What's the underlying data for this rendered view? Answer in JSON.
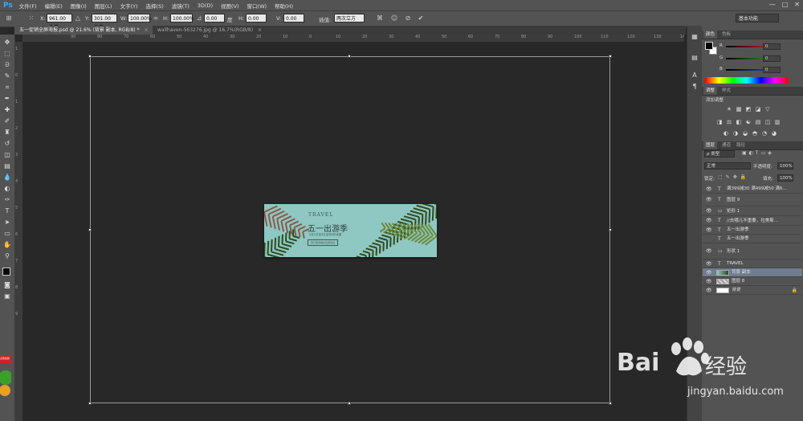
{
  "app": {
    "logo": "Ps"
  },
  "menu": [
    "文件(F)",
    "编辑(E)",
    "图像(I)",
    "图层(L)",
    "文字(Y)",
    "选择(S)",
    "滤镜(T)",
    "3D(D)",
    "视图(V)",
    "窗口(W)",
    "帮助(H)"
  ],
  "window_controls": [
    "—",
    "□",
    "✕"
  ],
  "options": {
    "x_label": "X:",
    "x_value": "961.00 像素",
    "y_label": "Y:",
    "y_value": "301.00 像素",
    "w_label": "W:",
    "w_value": "100.00%",
    "h_label": "H:",
    "h_value": "100.00%",
    "angle_value": "0.00",
    "hskew_label": "H:",
    "hskew_value": "0.00",
    "vskew_label": "V:",
    "vskew_value": "0.00",
    "interp_label": "插值:",
    "interp_value": "两次立方",
    "workspace": "基本功能"
  },
  "tabs": [
    {
      "label": "五一促销全屏海报.psd @ 21.6% (背景 副本, RGB/8) *",
      "close": "×"
    },
    {
      "label": "wallhaven-563276.jpg @ 16.7%(RGB/8)",
      "close": "×"
    }
  ],
  "ruler": {
    "top": [
      "90",
      "80",
      "70",
      "60",
      "50",
      "40",
      "30",
      "20",
      "10",
      "0",
      "10",
      "20",
      "30",
      "40",
      "50",
      "60",
      "70",
      "80",
      "90",
      "100",
      "110",
      "120",
      "130",
      "140",
      "150"
    ],
    "left": [
      "1",
      "0",
      "1",
      "2",
      "3",
      "4",
      "5",
      "6",
      "7",
      "8",
      "9"
    ]
  },
  "artwork": {
    "title": "TRAVEL",
    "headline": "五一出游季",
    "subline": "5月1日至5日全场5折优惠",
    "button": "预订更多精彩出游活动",
    "colors": {
      "sky": "#8fc7c2",
      "leaf": "#2f4a1e",
      "leaf_light": "#6b8a3a"
    }
  },
  "color_panel": {
    "tabs": [
      "颜色",
      "色板"
    ],
    "sliders": [
      {
        "letter": "R",
        "value": "0",
        "color": "#d42020"
      },
      {
        "letter": "G",
        "value": "0",
        "color": "#20a020"
      },
      {
        "letter": "B",
        "value": "0",
        "color": "#2040d0"
      }
    ]
  },
  "adjust_panel": {
    "tabs": [
      "调整",
      "样式"
    ],
    "title": "添加调整"
  },
  "layers_panel": {
    "tabs": [
      "图层",
      "通道",
      "路径"
    ],
    "filter_label": "ρ 类型",
    "blend_mode": "正常",
    "opacity_label": "不透明度:",
    "opacity_value": "100%",
    "lock_label": "锁定:",
    "fill_label": "填充:",
    "fill_value": "100%",
    "layers": [
      {
        "type": "T",
        "name": "满399减30 满499减50 满6...",
        "visible": true,
        "selected": false,
        "thumb": "none"
      },
      {
        "type": "T",
        "name": "图层 9",
        "visible": true,
        "selected": false,
        "thumb": "none"
      },
      {
        "type": "▭",
        "name": "矩形 1",
        "visible": true,
        "selected": false,
        "thumb": "none"
      },
      {
        "type": "T",
        "name": "//去哪儿不重要，拉美斯...",
        "visible": true,
        "selected": false,
        "thumb": "none"
      },
      {
        "type": "T",
        "name": "五一出游季",
        "visible": true,
        "selected": false,
        "thumb": "none"
      },
      {
        "type": "T",
        "name": "五一出游季",
        "visible": false,
        "selected": false,
        "thumb": "none"
      },
      {
        "type": "▭",
        "name": "形状 1",
        "visible": true,
        "selected": false,
        "thumb": "none"
      },
      {
        "type": "T",
        "name": "TRAVEL",
        "visible": true,
        "selected": false,
        "thumb": "none"
      },
      {
        "type": "",
        "name": "背景 副本",
        "visible": true,
        "selected": true,
        "thumb": "photo"
      },
      {
        "type": "",
        "name": "图层 8",
        "visible": true,
        "selected": false,
        "thumb": "checker"
      },
      {
        "type": "",
        "name": "背景",
        "visible": true,
        "selected": false,
        "thumb": "white",
        "locked": true
      }
    ]
  },
  "watermark": {
    "brand": "Bai",
    "brand2": "经验",
    "url": "jingyan.baidu.com"
  },
  "badge": {
    "text": "点我加薪"
  }
}
